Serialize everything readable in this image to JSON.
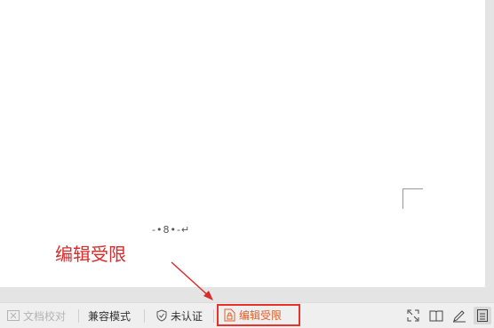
{
  "document": {
    "page_number_text": "-•8•-↵"
  },
  "annotation": {
    "text": "编辑受限",
    "color": "#d92b2b"
  },
  "statusbar": {
    "doc_check_label": "文档校对",
    "compat_mode_label": "兼容模式",
    "unverified_label": "未认证",
    "edit_limited_label": "编辑受限",
    "accent_color": "#e0602a"
  },
  "right_icons": [
    "fullscreen-icon",
    "reading-mode-icon",
    "edit-mode-icon",
    "page-view-icon"
  ]
}
